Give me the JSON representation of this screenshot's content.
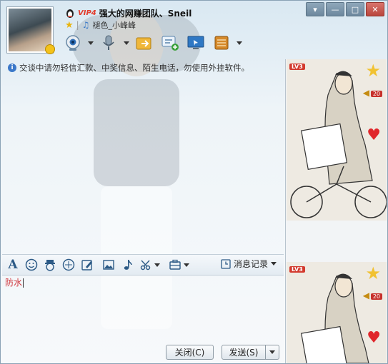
{
  "header": {
    "vip_label": "VIP4",
    "contact_name": "强大的网赚团队、Sneil",
    "signature": "褪色_小峰峰"
  },
  "window_controls": {
    "menu": "▾",
    "minimize": "—",
    "maximize": "□",
    "close": "✕"
  },
  "chat": {
    "notice": "交谈中请勿轻信汇款、中奖信息、陌生电话，勿使用外挂软件。"
  },
  "format_toolbar": {
    "history_label": "消息记录"
  },
  "input": {
    "value": "防水"
  },
  "buttons": {
    "close": "关闭(C)",
    "send": "发送(S)"
  },
  "show_panel": {
    "level": "LV3",
    "badge_count": "20"
  }
}
